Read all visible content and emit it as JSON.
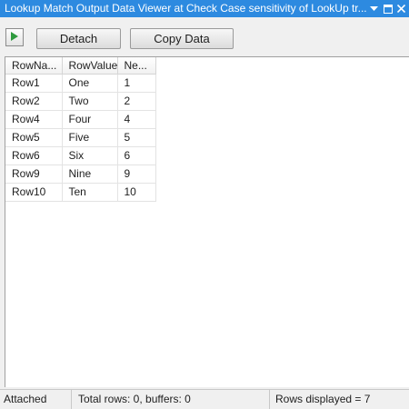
{
  "window": {
    "title": "Lookup Match Output Data Viewer at Check Case sensitivity of LookUp tr...",
    "colors": {
      "titlebar": "#2d8ae0",
      "run_arrow": "#2e9a3e"
    }
  },
  "titlebar_buttons": {
    "dropdown_icon": "chevron-down-icon",
    "pin_icon": "window-restore-icon",
    "close_icon": "close-icon"
  },
  "toolbar": {
    "run_icon": "play-icon",
    "detach_label": "Detach",
    "copy_label": "Copy Data"
  },
  "grid": {
    "columns": [
      "RowNa...",
      "RowValue",
      "Ne..."
    ],
    "rows": [
      [
        "Row1",
        "One",
        "1"
      ],
      [
        "Row2",
        "Two",
        "2"
      ],
      [
        "Row4",
        "Four",
        "4"
      ],
      [
        "Row5",
        "Five",
        "5"
      ],
      [
        "Row6",
        "Six",
        "6"
      ],
      [
        "Row9",
        "Nine",
        "9"
      ],
      [
        "Row10",
        "Ten",
        "10"
      ]
    ]
  },
  "status": {
    "state": "Attached",
    "totals": "Total rows: 0, buffers: 0",
    "displayed": "Rows displayed = 7"
  }
}
